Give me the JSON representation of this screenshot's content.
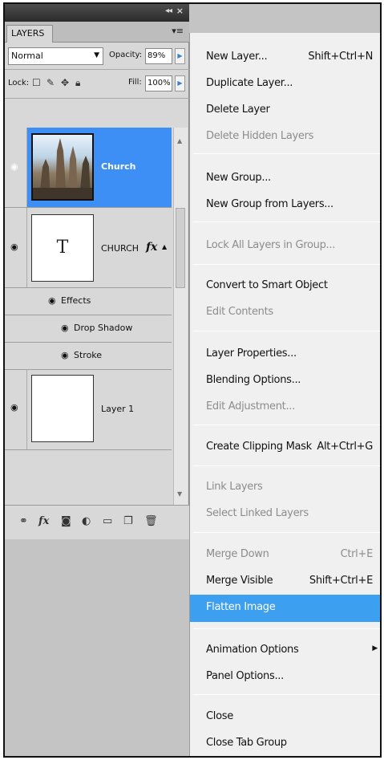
{
  "panel": {
    "tab_label": "LAYERS",
    "blend_mode": "Normal",
    "opacity_label": "Opacity:",
    "opacity_value": "89%",
    "lock_label": "Lock:",
    "fill_label": "Fill:",
    "fill_value": "100%",
    "layers": [
      {
        "name": "Church",
        "selected": true
      },
      {
        "name": "CHURCH",
        "thumb_text": "T"
      },
      {
        "name": "Layer 1"
      }
    ],
    "effects_label": "Effects",
    "effects": [
      "Drop Shadow",
      "Stroke"
    ],
    "fx_badge": "fx"
  },
  "menu": {
    "new_layer": {
      "label": "New Layer...",
      "shortcut": "Shift+Ctrl+N"
    },
    "duplicate_layer": {
      "label": "Duplicate Layer..."
    },
    "delete_layer": {
      "label": "Delete Layer"
    },
    "delete_hidden": {
      "label": "Delete Hidden Layers"
    },
    "new_group": {
      "label": "New Group..."
    },
    "new_group_from_layers": {
      "label": "New Group from Layers..."
    },
    "lock_all": {
      "label": "Lock All Layers in Group..."
    },
    "convert_smart": {
      "label": "Convert to Smart Object"
    },
    "edit_contents": {
      "label": "Edit Contents"
    },
    "layer_properties": {
      "label": "Layer Properties..."
    },
    "blending_options": {
      "label": "Blending Options..."
    },
    "edit_adjustment": {
      "label": "Edit Adjustment..."
    },
    "clipping_mask": {
      "label": "Create Clipping Mask",
      "shortcut": "Alt+Ctrl+G"
    },
    "link_layers": {
      "label": "Link Layers"
    },
    "select_linked": {
      "label": "Select Linked Layers"
    },
    "merge_down": {
      "label": "Merge Down",
      "shortcut": "Ctrl+E"
    },
    "merge_visible": {
      "label": "Merge Visible",
      "shortcut": "Shift+Ctrl+E"
    },
    "flatten": {
      "label": "Flatten Image"
    },
    "animation_options": {
      "label": "Animation Options"
    },
    "panel_options": {
      "label": "Panel Options..."
    },
    "close": {
      "label": "Close"
    },
    "close_tab_group": {
      "label": "Close Tab Group"
    }
  },
  "colors": {
    "selection": "#3d9ff0",
    "titlebar": "#3a3a3a",
    "menu_bg": "#f0f0f0",
    "disabled_text": "#8c8c8c"
  }
}
